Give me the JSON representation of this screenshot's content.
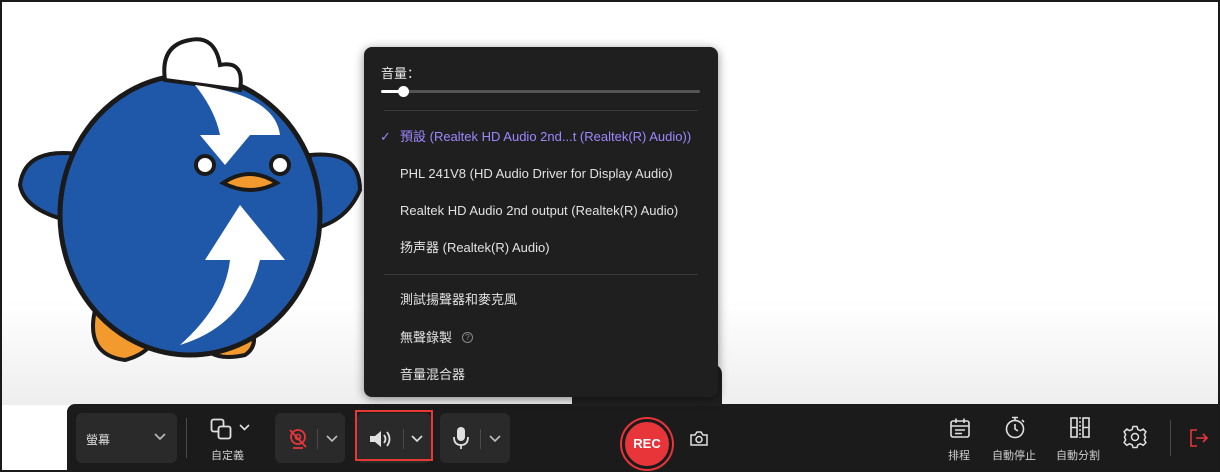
{
  "menu": {
    "volume_label": "音量：",
    "volume_level_percent": 7,
    "devices": [
      {
        "label": "預設 (Realtek HD Audio 2nd...t (Realtek(R) Audio))",
        "selected": true
      },
      {
        "label": "PHL 241V8 (HD Audio Driver for Display Audio)",
        "selected": false
      },
      {
        "label": "Realtek HD Audio 2nd output (Realtek(R) Audio)",
        "selected": false
      },
      {
        "label": "扬声器 (Realtek(R) Audio)",
        "selected": false
      }
    ],
    "actions": [
      {
        "label": "測試揚聲器和麥克風"
      },
      {
        "label": "無聲錄製"
      },
      {
        "label": "音量混合器"
      }
    ],
    "selected_color": "#9f86ff"
  },
  "toolbar": {
    "source_select": "螢幕",
    "region_label": "自定義",
    "rec_label": "REC",
    "schedule_label": "排程",
    "auto_stop_label": "自動停止",
    "auto_split_label": "自動分割",
    "rec_color": "#e8353a",
    "highlight_color": "#e53935"
  },
  "icons": {
    "region": "overlapping-squares-icon",
    "webcam": "webcam-off-icon",
    "speaker": "speaker-icon",
    "microphone": "microphone-icon",
    "screenshot": "camera-icon",
    "schedule": "calendar-icon",
    "auto_stop": "stopwatch-icon",
    "auto_split": "split-icon",
    "settings": "gear-icon",
    "exit": "exit-icon"
  }
}
